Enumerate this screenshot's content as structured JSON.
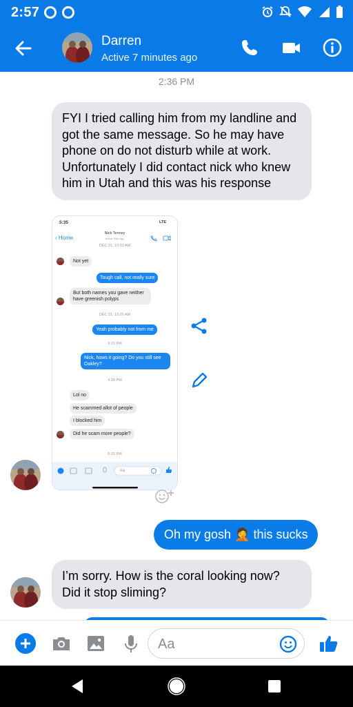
{
  "status_bar": {
    "time": "2:57"
  },
  "header": {
    "contact_name": "Darren",
    "presence": "Active 7 minutes ago"
  },
  "thread": {
    "timestamp": "2:36 PM",
    "messages": [
      {
        "text": "FYI I tried calling him from my landline and got the same message. So he may have phone on do not disturb while at work. Unfortunately I did contact nick who knew him in Utah and this was his response"
      },
      {
        "text": "Oh my gosh 🤦 this sucks"
      },
      {
        "text": "I’m sorry. How is the coral looking now? Did it stop sliming?"
      }
    ]
  },
  "screenshot": {
    "time": "5:35",
    "network": "LTE",
    "back_label": "Home",
    "contact": "Nick Tenney",
    "presence": "Active 53m ago",
    "top_ts": "DEC 21, 10:03 AM",
    "msgs": [
      "Not yet",
      "Tough call, not really sure",
      "But both names you gave neither have greenish polyps",
      "DEC 21, 10:26 AM",
      "Yeah probably not from me",
      "9:21 PM",
      "Nick, hows it going? Do you still see Oakley?",
      "4:39 PM",
      "Lol no",
      "He scammed allot of people",
      "I blocked him",
      "Did he scam more people?",
      "5:31 PM"
    ],
    "composer_placeholder": "Aa"
  },
  "composer": {
    "placeholder": "Aa"
  },
  "colors": {
    "brand": "#0a7ae6",
    "bubble_out": "#0a7ce7",
    "bubble_in": "#e4e6eb"
  }
}
